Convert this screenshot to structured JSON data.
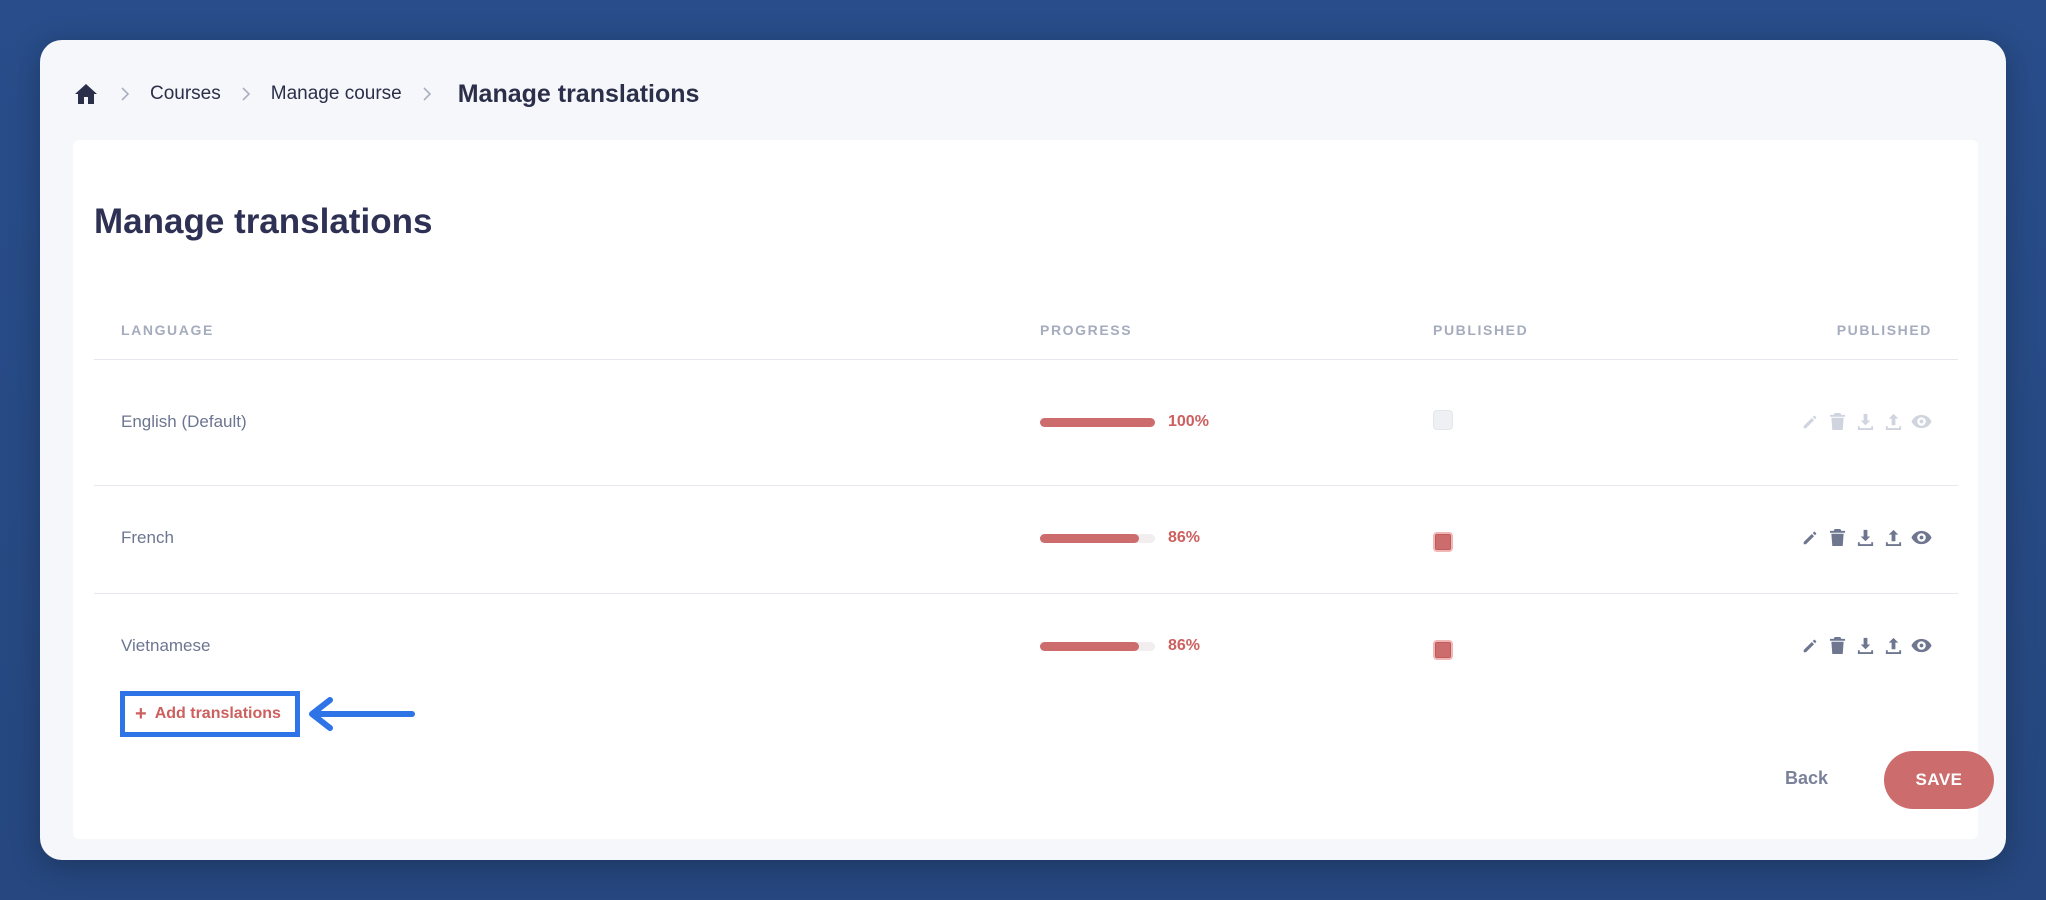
{
  "breadcrumb": {
    "items": [
      "Courses",
      "Manage course"
    ],
    "current": "Manage translations"
  },
  "page": {
    "title": "Manage translations"
  },
  "table": {
    "columns": [
      "LANGUAGE",
      "PROGRESS",
      "PUBLISHED",
      "PUBLISHED"
    ],
    "rows": [
      {
        "language": "English (Default)",
        "progress": 100,
        "progress_label": "100%",
        "published": "disabled",
        "actions_enabled": false
      },
      {
        "language": "French",
        "progress": 86,
        "progress_label": "86%",
        "published": "checked",
        "actions_enabled": true
      },
      {
        "language": "Vietnamese",
        "progress": 86,
        "progress_label": "86%",
        "published": "checked",
        "actions_enabled": true
      }
    ],
    "row_actions": [
      "edit-icon",
      "trash-icon",
      "download-icon",
      "upload-icon",
      "eye-icon"
    ]
  },
  "add_button": {
    "icon": "+",
    "label": "Add translations"
  },
  "footer": {
    "back_label": "Back",
    "save_label": "SAVE"
  },
  "colors": {
    "accent": "#cd6c6c",
    "highlight": "#2f74e6",
    "background": "#284d8a"
  }
}
